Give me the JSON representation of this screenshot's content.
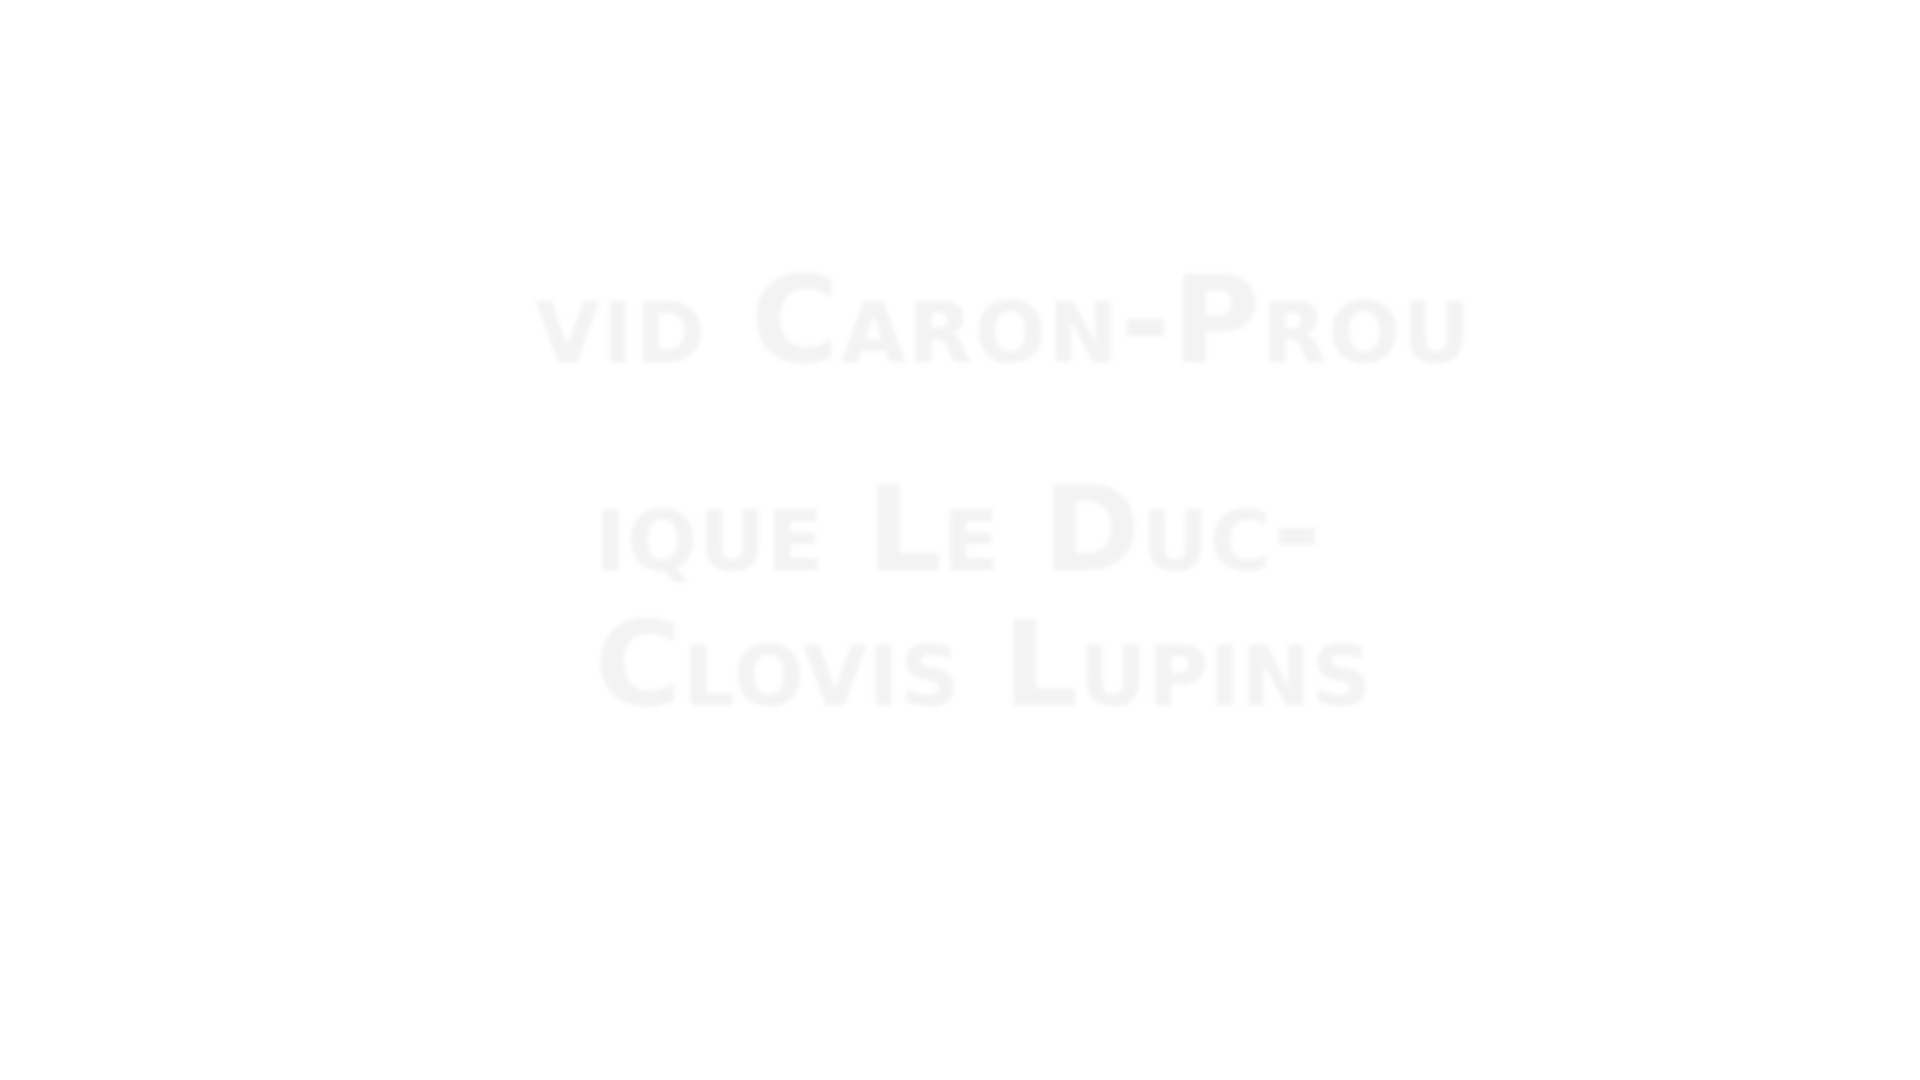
{
  "credits": {
    "line_1": "vid Caron-Prou",
    "line_2": "ique Le Duc-",
    "line_3": "Clovis Lupins"
  },
  "colors": {
    "background": "#ffffff",
    "text": "#f3f3f3"
  }
}
